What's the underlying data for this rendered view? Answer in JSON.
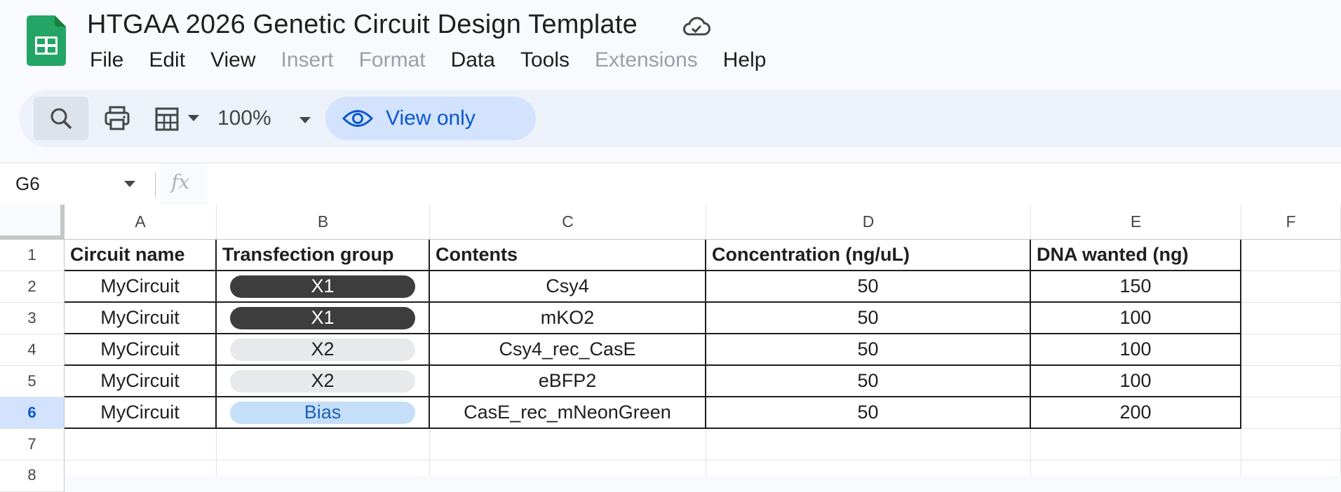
{
  "app": {
    "title": "HTGAA 2026 Genetic Circuit Design Template"
  },
  "menu": [
    "File",
    "Edit",
    "View",
    "Insert",
    "Format",
    "Data",
    "Tools",
    "Extensions",
    "Help"
  ],
  "toolbar": {
    "zoom": "100%",
    "view_only_label": "View only"
  },
  "formula_bar": {
    "cell_ref": "G6",
    "fx": "fx"
  },
  "columns": [
    "A",
    "B",
    "C",
    "D",
    "E",
    "F"
  ],
  "rows": [
    "1",
    "2",
    "3",
    "4",
    "5",
    "6",
    "7",
    "8"
  ],
  "table": {
    "headers": [
      "Circuit name",
      "Transfection group",
      "Contents",
      "Concentration (ng/uL)",
      "DNA wanted (ng)"
    ],
    "rows": [
      {
        "circuit": "MyCircuit",
        "group": "X1",
        "contents": "Csy4",
        "conc": "50",
        "dna": "150"
      },
      {
        "circuit": "MyCircuit",
        "group": "X1",
        "contents": "mKO2",
        "conc": "50",
        "dna": "100"
      },
      {
        "circuit": "MyCircuit",
        "group": "X2",
        "contents": "Csy4_rec_CasE",
        "conc": "50",
        "dna": "100"
      },
      {
        "circuit": "MyCircuit",
        "group": "X2",
        "contents": "eBFP2",
        "conc": "50",
        "dna": "100"
      },
      {
        "circuit": "MyCircuit",
        "group": "Bias",
        "contents": "CasE_rec_mNeonGreen",
        "conc": "50",
        "dna": "200"
      }
    ]
  },
  "chip_colors": {
    "X1": {
      "bg": "#3d3d3d",
      "fg": "#ffffff"
    },
    "X2": {
      "bg": "#e8e9eb",
      "fg": "#1f1f1f"
    },
    "Bias": {
      "bg": "#c5dff8",
      "fg": "#1d5fb8"
    }
  },
  "colors": {
    "brand": "#23a566",
    "accent": "#0b57d0",
    "selected_row": "#d3e3fd"
  }
}
